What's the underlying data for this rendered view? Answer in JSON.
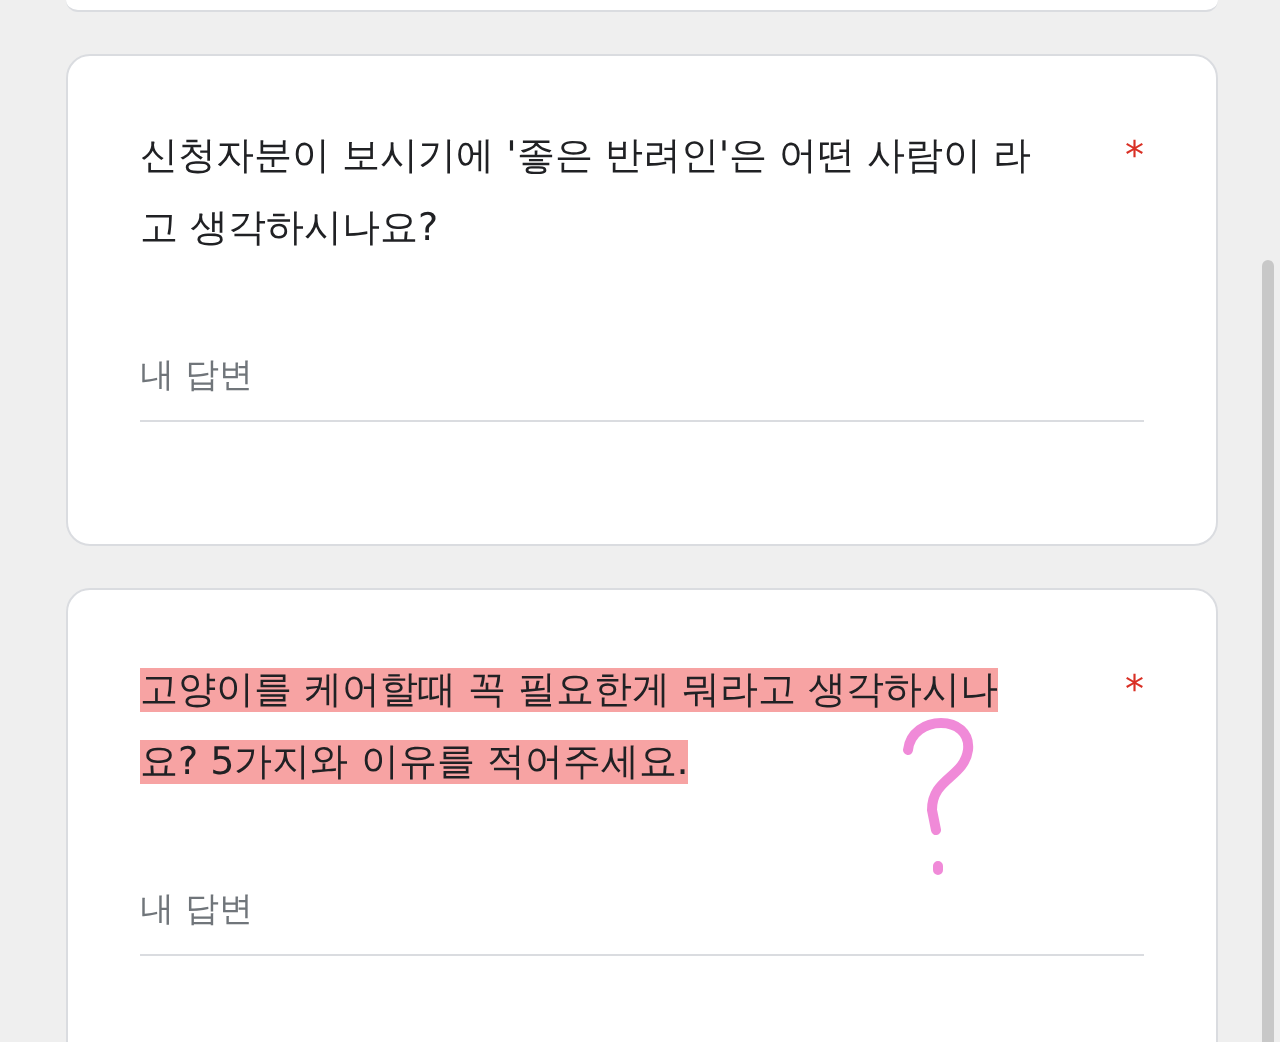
{
  "questions": [
    {
      "text": "신청자분이 보시기에 '좋은 반려인'은 어떤 사람이 라고 생각하시나요?",
      "required": true,
      "required_mark": "*",
      "highlighted": false,
      "placeholder": "내 답변"
    },
    {
      "text": "고양이를 케어할때 꼭 필요한게 뭐라고 생각하시나요? 5가지와 이유를 적어주세요.",
      "required": true,
      "required_mark": "*",
      "highlighted": true,
      "placeholder": "내 답변"
    }
  ]
}
